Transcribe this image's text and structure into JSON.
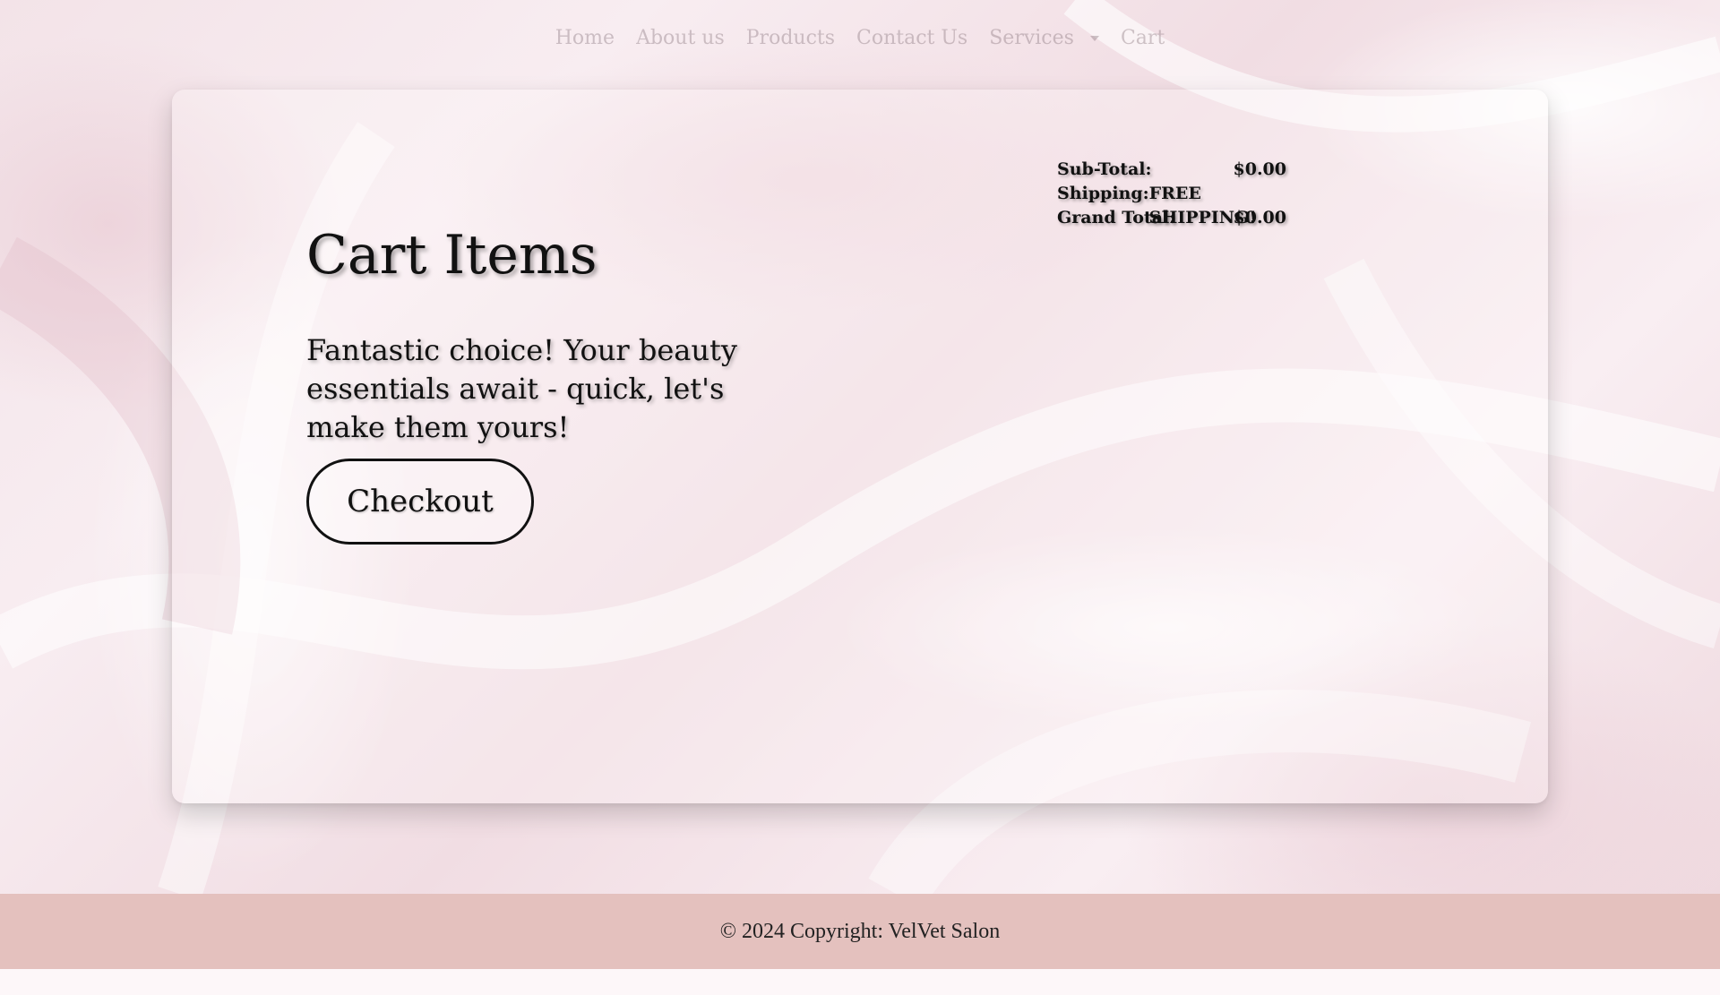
{
  "nav": {
    "items": [
      {
        "label": "Home"
      },
      {
        "label": "About us"
      },
      {
        "label": "Products"
      },
      {
        "label": "Contact Us"
      },
      {
        "label": "Services",
        "dropdown": true
      },
      {
        "label": "Cart"
      }
    ]
  },
  "cart": {
    "title": "Cart Items",
    "message": "Fantastic choice! Your beauty essentials await - quick, let's make them yours!",
    "checkout_label": "Checkout",
    "summary": {
      "subtotal_label": "Sub-Total:",
      "subtotal_value": "$0.00",
      "shipping_label": "Shipping:",
      "shipping_value": "FREE SHIPPING!",
      "grand_total_label": "Grand Total:",
      "grand_total_value": "$0.00"
    }
  },
  "footer": {
    "copyright": "© 2024 Copyright: VelVet Salon"
  },
  "colors": {
    "footer_bg": "#e4c1be",
    "background": "#f3e3e8",
    "text": "#111111"
  }
}
